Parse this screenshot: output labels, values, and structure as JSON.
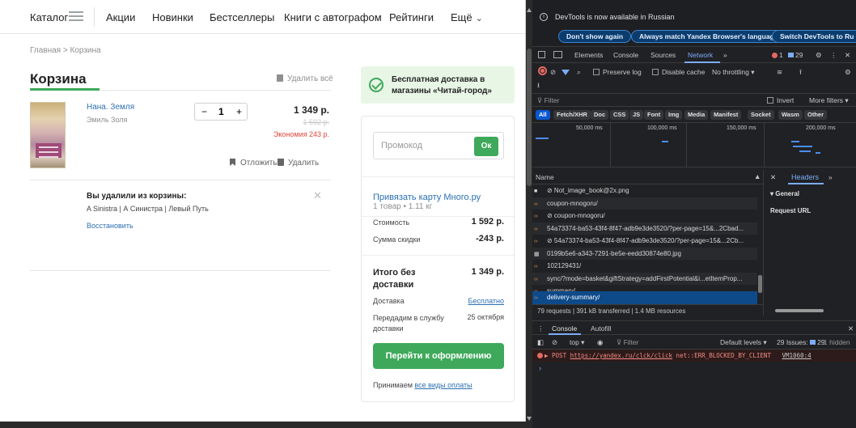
{
  "nav": {
    "catalog": "Каталог",
    "items": [
      "Акции",
      "Новинки",
      "Бестселлеры",
      "Книги с автографом",
      "Рейтинги",
      "Ещё"
    ]
  },
  "breadcrumb": "Главная > Корзина",
  "cart": {
    "title": "Корзина",
    "delete_all": "Удалить всё",
    "item": {
      "title": "Нана. Земля",
      "author": "Эмиль Золя",
      "qty": "1",
      "minus": "−",
      "plus": "+",
      "price": "1 349 р.",
      "old_price": "1 592 р.",
      "savings": "Экономия 243 р.",
      "postpone": "Отложить",
      "remove": "Удалить"
    },
    "removed": {
      "title": "Вы удалили из корзины:",
      "list": "A Sinistra | А Синистра | Левый Путь",
      "restore": "Восстановить",
      "close": "✕"
    }
  },
  "summary": {
    "banner": "Бесплатная доставка в магазины «Читай-город»",
    "promo_placeholder": "Промокод",
    "promo_button": "Ок",
    "link_card": "Привязать карту Много.ру",
    "items_count": "1 товар • 1.11 кг",
    "cost_label": "Стоимость",
    "cost_value": "1 592 р.",
    "discount_label": "Сумма скидки",
    "discount_value": "-243 р.",
    "total_label": "Итого без доставки",
    "total_value": "1 349 р.",
    "delivery_label": "Доставка",
    "delivery_value": "Бесплатно",
    "handover_label": "Передадим в службу доставки",
    "handover_value": "25 октября",
    "checkout_button": "Перейти к оформлению",
    "pay_prefix": "Принимаем ",
    "pay_link": "все виды оплаты"
  },
  "devtools": {
    "info_text": "DevTools is now available in Russian",
    "btn_dont_show": "Don't show again",
    "btn_match": "Always match Yandex Browser's language",
    "btn_switch": "Switch DevTools to Ru",
    "tabs": [
      "Elements",
      "Console",
      "Sources",
      "Network",
      "»"
    ],
    "error_count": "1",
    "msg_count": "29",
    "preserve_log": "Preserve log",
    "disable_cache": "Disable cache",
    "throttling": "No throttling",
    "filter_placeholder": "Filter",
    "invert": "Invert",
    "more_filters": "More filters",
    "chips": [
      "All",
      "Fetch/XHR",
      "Doc",
      "CSS",
      "JS",
      "Font",
      "Img",
      "Media",
      "Manifest",
      "Socket",
      "Wasm",
      "Other"
    ],
    "timeline_ticks": [
      "50,000 ms",
      "100,000 ms",
      "150,000 ms",
      "200,000 ms"
    ],
    "name_header": "Name",
    "requests": [
      {
        "icon": "img",
        "name": "⊘ Not_image_book@2x.png"
      },
      {
        "icon": "xhr",
        "name": "coupon-mnogoru/"
      },
      {
        "icon": "xhr",
        "name": "⊘ coupon-mnogoru/"
      },
      {
        "icon": "xhr",
        "name": "54a73374-ba53-43f4-8f47-adb9e3de3520/?per-page=15&...2Cbad..."
      },
      {
        "icon": "xhr",
        "name": "⊘ 54a73374-ba53-43f4-8f47-adb9e3de3520/?per-page=15&...2Cb..."
      },
      {
        "icon": "img",
        "name": "0199b5e6-a343-7291-be5e-eedd30874e80.jpg"
      },
      {
        "icon": "xhr",
        "name": "102129431/"
      },
      {
        "icon": "xhr",
        "name": "sync/?mode=basket&giftStrategy=addFirstPotential&i...etItemProp..."
      },
      {
        "icon": "xhr",
        "name": "summary/"
      },
      {
        "icon": "xhr",
        "name": "delivery-summary/"
      }
    ],
    "status": "79 requests  |  391 kB transferred  |  1.4 MB resources",
    "panel_close": "✕",
    "panel_tab": "Headers",
    "panel_more": "»",
    "panel_general": "▾ General",
    "panel_request_url": "Request URL",
    "console_tabs": [
      "Console",
      "Autofill"
    ],
    "console_close": "✕",
    "console_context": "top ▾",
    "console_filter": "Filter",
    "console_levels": "Default levels ▾",
    "console_issues_prefix": "29 Issues:",
    "console_issues_count": "29",
    "console_hidden": "1 hidden",
    "error_prefix": "▶ POST ",
    "error_url": "https://yandex.ru/clck/click",
    "error_msg": " net::ERR_BLOCKED_BY_CLIENT",
    "error_source": "VM1060:4"
  },
  "colors": {
    "brand_green": "#3fa95b",
    "link_blue": "#2c6fb3",
    "sale_red": "#e0453a",
    "devtools_bg": "#202124",
    "devtools_accent": "#7cacf8"
  }
}
